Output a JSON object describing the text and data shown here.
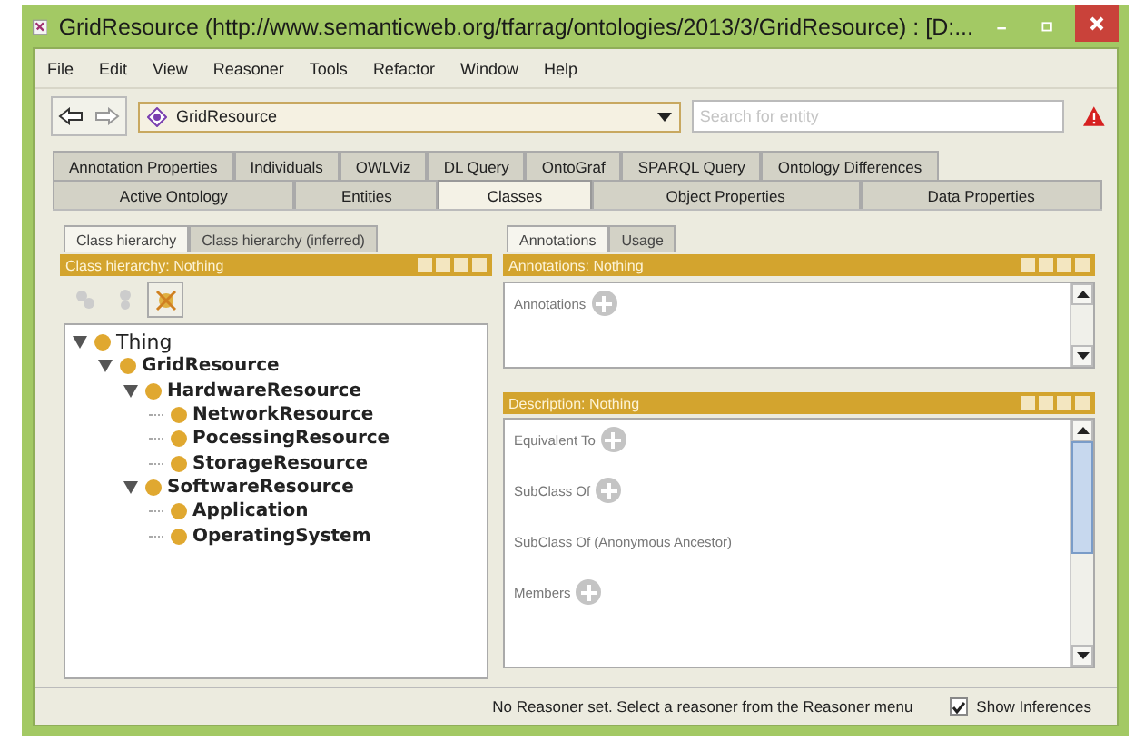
{
  "window": {
    "title": "GridResource (http://www.semanticweb.org/tfarrag/ontologies/2013/3/GridResource)  : [D:..."
  },
  "menu": [
    "File",
    "Edit",
    "View",
    "Reasoner",
    "Tools",
    "Refactor",
    "Window",
    "Help"
  ],
  "toolbar": {
    "ontology": "GridResource",
    "search": {
      "placeholder": "Search for entity"
    }
  },
  "tab_rows": [
    [
      {
        "label": "Annotation Properties",
        "selected": false
      },
      {
        "label": "Individuals",
        "selected": false
      },
      {
        "label": "OWLViz",
        "selected": false
      },
      {
        "label": "DL Query",
        "selected": false
      },
      {
        "label": "OntoGraf",
        "selected": false
      },
      {
        "label": "SPARQL Query",
        "selected": false
      },
      {
        "label": "Ontology Differences",
        "selected": false
      }
    ],
    [
      {
        "label": "Active Ontology",
        "selected": false
      },
      {
        "label": "Entities",
        "selected": false
      },
      {
        "label": "Classes",
        "selected": true
      },
      {
        "label": "Object Properties",
        "selected": false
      },
      {
        "label": "Data Properties",
        "selected": false
      }
    ]
  ],
  "left": {
    "tabs": [
      {
        "label": "Class hierarchy",
        "selected": true
      },
      {
        "label": "Class hierarchy (inferred)",
        "selected": false
      }
    ],
    "header": "Class hierarchy: Nothing",
    "tree": [
      {
        "label": "Thing",
        "expanded": true,
        "children": [
          {
            "label": "GridResource",
            "expanded": true,
            "children": [
              {
                "label": "HardwareResource",
                "expanded": true,
                "children": [
                  {
                    "label": "NetworkResource"
                  },
                  {
                    "label": "PocessingResource"
                  },
                  {
                    "label": "StorageResource"
                  }
                ]
              },
              {
                "label": "SoftwareResource",
                "expanded": true,
                "children": [
                  {
                    "label": "Application"
                  },
                  {
                    "label": "OperatingSystem"
                  }
                ]
              }
            ]
          }
        ]
      }
    ]
  },
  "right": {
    "tabs": [
      {
        "label": "Annotations",
        "selected": true
      },
      {
        "label": "Usage",
        "selected": false
      }
    ],
    "annotations": {
      "header": "Annotations: Nothing",
      "rows": [
        {
          "label": "Annotations",
          "add": true
        }
      ]
    },
    "description": {
      "header": "Description: Nothing",
      "rows": [
        {
          "label": "Equivalent To",
          "add": true
        },
        {
          "label": "SubClass Of",
          "add": true
        },
        {
          "label": "SubClass Of (Anonymous Ancestor)",
          "add": false
        },
        {
          "label": "Members",
          "add": true
        }
      ]
    }
  },
  "status_bar": {
    "message": "No Reasoner set. Select a reasoner from the Reasoner menu",
    "show_inferences": {
      "label": "Show Inferences",
      "checked": true
    }
  }
}
